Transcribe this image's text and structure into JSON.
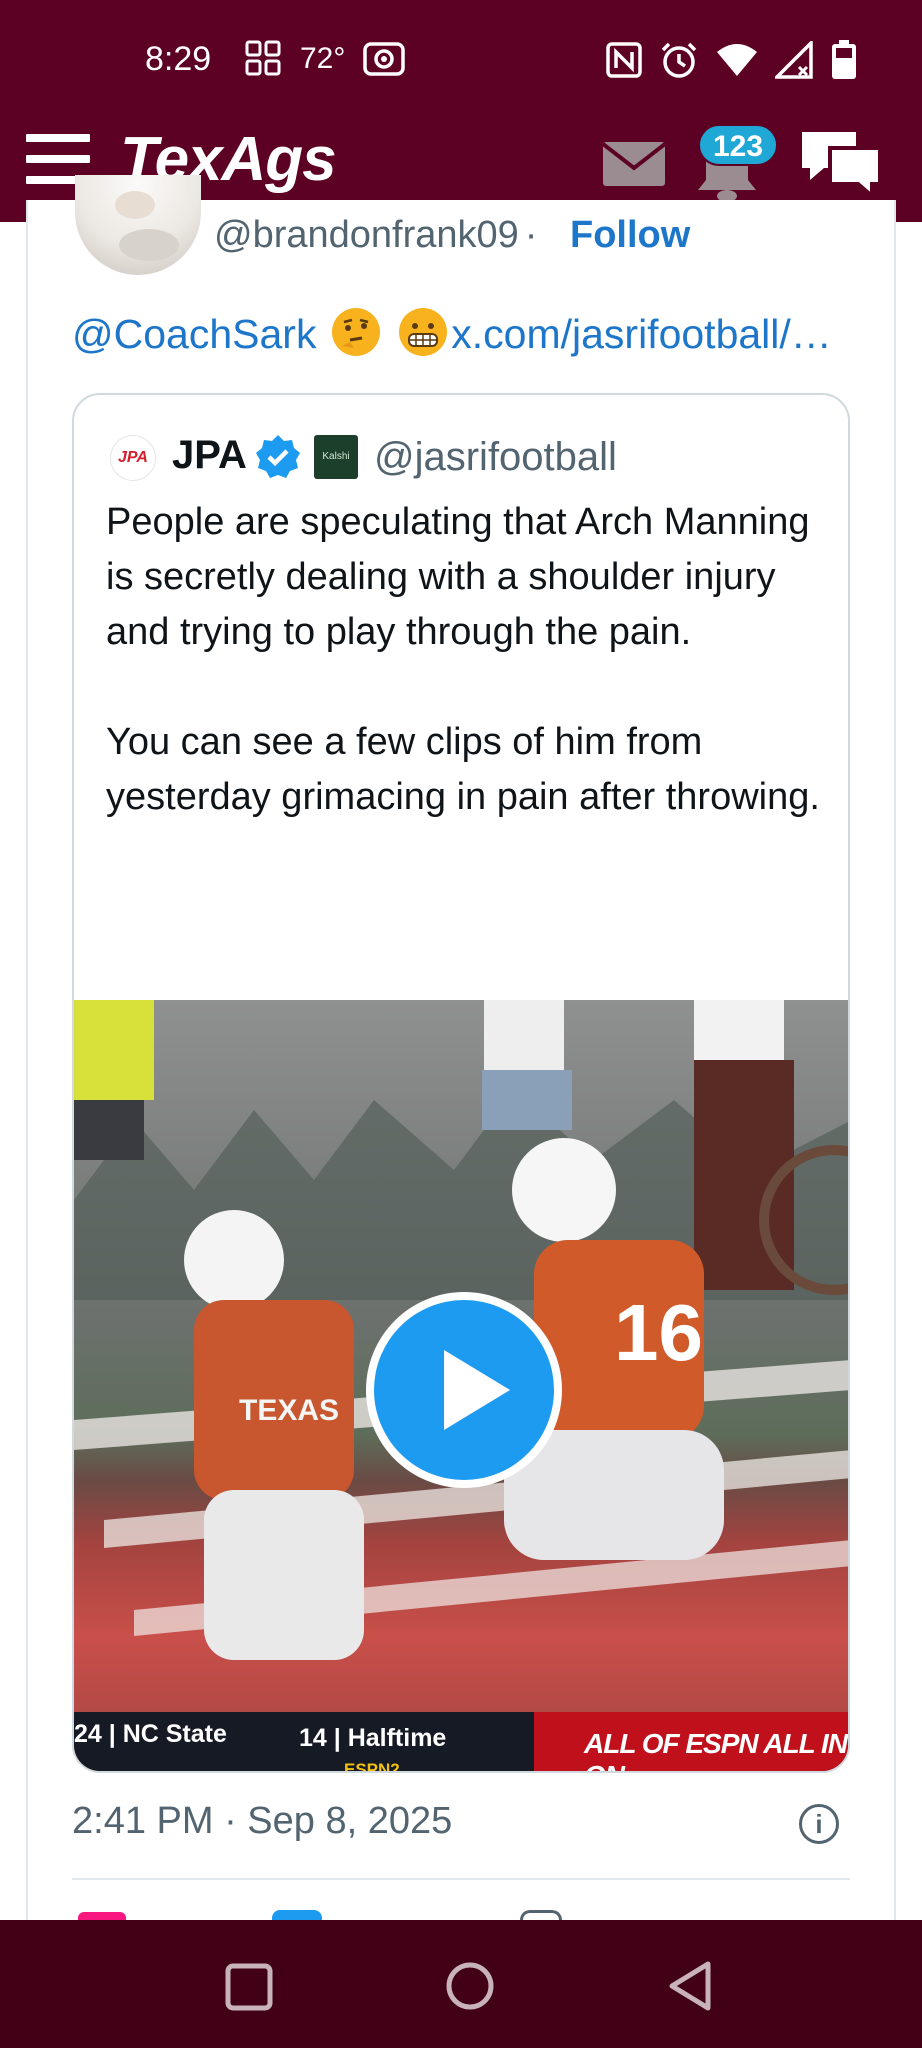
{
  "status_bar": {
    "time": "8:29",
    "temperature": "72°",
    "icons": [
      "widgets-icon",
      "cast-icon",
      "nfc-icon",
      "alarm-icon",
      "wifi-icon",
      "signal-icon",
      "battery-icon"
    ]
  },
  "header": {
    "logo": "TexAgs",
    "notification_count": "123",
    "colors": {
      "brand": "#5c0024",
      "badge": "#1fa7d6"
    }
  },
  "post": {
    "handle": "@brandonfrank09",
    "separator": "·",
    "follow_label": "Follow",
    "text_mention": "@CoachSark",
    "text_link": "x.com/jasrifootball/…",
    "emojis": [
      "thinking-face",
      "grimacing-face"
    ]
  },
  "quoted_tweet": {
    "logo_text": "JPA",
    "name": "JPA",
    "badge_text": "Kalshi",
    "handle": "@jasrifootball",
    "body": "People are speculating that Arch Manning is secretly dealing with a shoulder injury  and trying to play through the pain.\n\nYou can see a few clips of him from yesterday grimacing in pain after throwing.",
    "video": {
      "score_left": "24 | NC State",
      "score_right": "14 | Halftime",
      "network": "ESPN2",
      "banner": "ALL OF ESPN  ALL IN ON",
      "jersey_left": "TEXAS",
      "jersey_number": "16"
    }
  },
  "meta": {
    "timestamp": "2:41 PM · Sep 8, 2025",
    "info_glyph": "i"
  },
  "nav_bar": {
    "buttons": [
      "recents-icon",
      "home-icon",
      "back-icon"
    ]
  }
}
